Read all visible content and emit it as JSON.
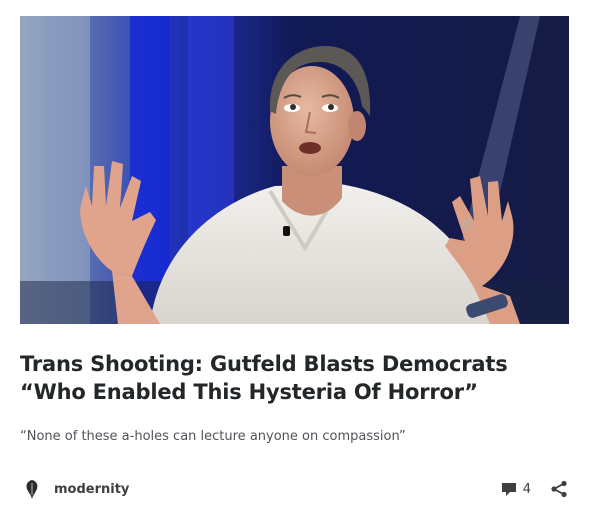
{
  "post": {
    "title": "Trans Shooting: Gutfeld Blasts Democrats “Who Enabled This Hysteria Of Horror”",
    "excerpt": "“None of these a-holes can lecture anyone on compassion”",
    "author": "modernity",
    "comment_count": "4"
  },
  "icons": {
    "comment": "comment-bubble-icon",
    "share": "share-icon",
    "avatar": "feather-pen-avatar"
  },
  "colors": {
    "text": "#242729",
    "muted": "#4f5358",
    "meta": "#3c4043"
  }
}
